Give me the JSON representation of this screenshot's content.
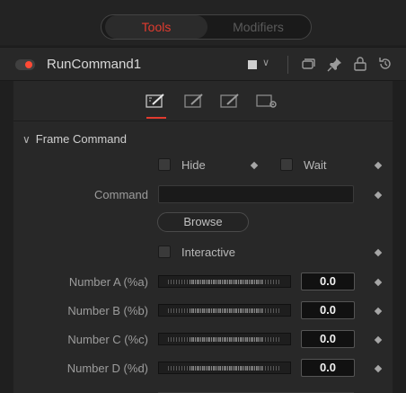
{
  "tabs": {
    "tools": "Tools",
    "modifiers": "Modifiers"
  },
  "header": {
    "title": "RunCommand1",
    "toggle_color": "#ff4a35",
    "active_tab_color": "#e23b2f"
  },
  "inspector_tabs": [
    "controls-tab-icon",
    "tab-2-icon",
    "tab-3-icon",
    "settings-tab-icon"
  ],
  "section": {
    "title": "Frame Command",
    "expanded": true
  },
  "hide": {
    "label": "Hide",
    "checked": false
  },
  "wait": {
    "label": "Wait",
    "checked": false
  },
  "command": {
    "label": "Command",
    "value": ""
  },
  "browse": {
    "label": "Browse"
  },
  "interactive": {
    "label": "Interactive",
    "checked": false
  },
  "numbers": [
    {
      "label": "Number A (%a)",
      "value": "0.0"
    },
    {
      "label": "Number B (%b)",
      "value": "0.0"
    },
    {
      "label": "Number C (%c)",
      "value": "0.0"
    },
    {
      "label": "Number D (%d)",
      "value": "0.0"
    }
  ]
}
